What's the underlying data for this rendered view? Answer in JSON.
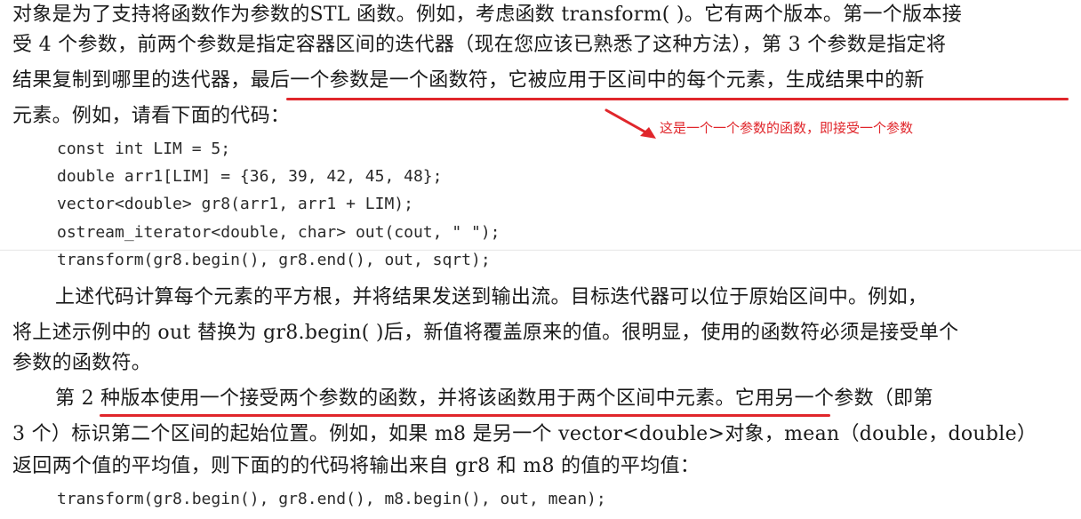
{
  "paragraph1": {
    "line1": "对象是为了支持将函数作为参数的STL 函数。例如，考虑函数 transform( )。它有两个版本。第一个版本接",
    "line2": "受 4 个参数，前两个参数是指定容器区间的迭代器（现在您应该已熟悉了这种方法），第 3 个参数是指定将",
    "line3": "结果复制到哪里的迭代器，最后一个参数是一个函数符，它被应用于区间中的每个元素，生成结果中的新",
    "line4": "元素。例如，请看下面的代码："
  },
  "annotation": {
    "text": "这是一个一个参数的函数，即接受一个参数",
    "color": "#e0262b"
  },
  "code1": [
    "const int LIM = 5;",
    "double arr1[LIM] = {36, 39, 42, 45, 48};",
    "vector<double> gr8(arr1, arr1 + LIM);",
    "ostream_iterator<double, char> out(cout, \" \");",
    "transform(gr8.begin(), gr8.end(), out, sqrt);"
  ],
  "paragraph2": {
    "line1": "上述代码计算每个元素的平方根，并将结果发送到输出流。目标迭代器可以位于原始区间中。例如，",
    "line2": "将上述示例中的 out 替换为 gr8.begin( )后，新值将覆盖原来的值。很明显，使用的函数符必须是接受单个",
    "line3": "参数的函数符。"
  },
  "paragraph3": {
    "line1": "第 2 种版本使用一个接受两个参数的函数，并将该函数用于两个区间中元素。它用另一个参数（即第",
    "line2": "3 个）标识第二个区间的起始位置。例如，如果 m8 是另一个 vector<double>对象，mean（double，double）",
    "line3": "返回两个值的平均值，则下面的的代码将输出来自 gr8 和 m8 的值的平均值："
  },
  "code2": "transform(gr8.begin(), gr8.end(), m8.begin(), out, mean);"
}
